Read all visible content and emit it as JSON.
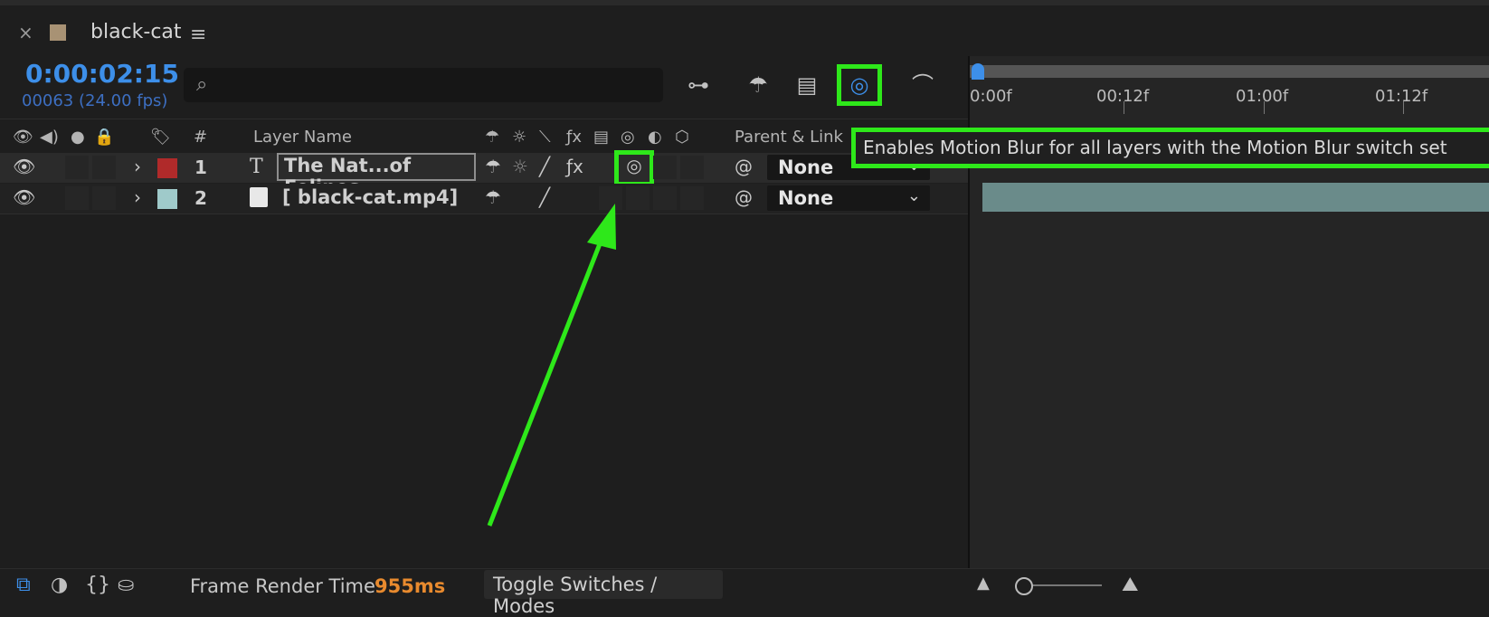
{
  "tab": {
    "close": "×",
    "name": "black-cat",
    "menu": "≡"
  },
  "time": {
    "timecode": "0:00:02:15",
    "frames": "00063 (24.00 fps)"
  },
  "search": {
    "placeholder": ""
  },
  "header": {
    "layer_name": "Layer Name",
    "hash": "#",
    "parent_link": "Parent & Link"
  },
  "layers": [
    {
      "index": "1",
      "name": "The Nat...of Felines",
      "type_icon": "T",
      "color": "#b02a2a",
      "parent": "None"
    },
    {
      "index": "2",
      "name": "[ black-cat.mp4]",
      "type_icon": "film",
      "color": "#9fcaca",
      "parent": "None"
    }
  ],
  "timeline": {
    "ticks": [
      "0:00f",
      "00:12f",
      "01:00f",
      "01:12f"
    ]
  },
  "tooltip": "Enables Motion Blur for all layers with the Motion Blur switch set",
  "bottom": {
    "frame_render_label": "Frame Render Time",
    "frame_render_value": "955ms",
    "toggle_label": "Toggle Switches / Modes"
  },
  "colors": {
    "accent": "#3d8fe9",
    "highlight": "#2ee81a",
    "render_time": "#e88a2e"
  }
}
